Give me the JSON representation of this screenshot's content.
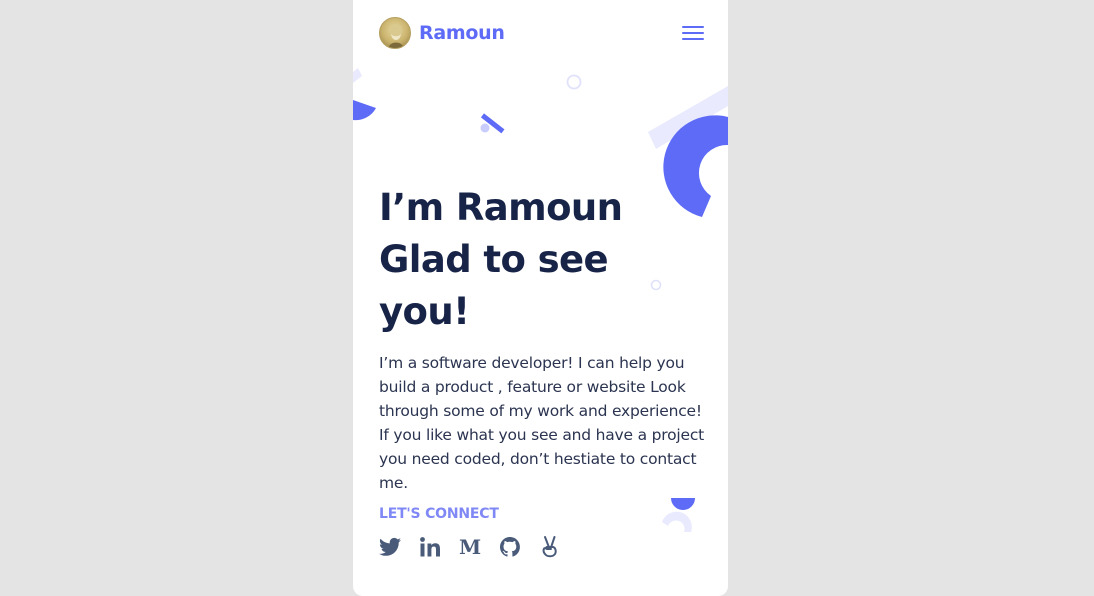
{
  "header": {
    "brand_name": "Ramoun",
    "menu_icon": "hamburger-menu-icon"
  },
  "hero": {
    "headline_line1": "I’m Ramoun",
    "headline_line2": "Glad to see",
    "headline_line3": "you!",
    "intro": "I’m a software developer! I can help you build a product , feature or website Look through some of my work and experience! If you like what you see and have a project you need coded, don’t hestiate to contact me."
  },
  "connect": {
    "label": "LET'S CONNECT",
    "links": [
      {
        "icon": "twitter-icon"
      },
      {
        "icon": "linkedin-icon"
      },
      {
        "icon": "medium-icon"
      },
      {
        "icon": "github-icon"
      },
      {
        "icon": "angellist-icon"
      }
    ]
  },
  "colors": {
    "accent": "#5d6bf6",
    "accent_light": "#e9eafd",
    "heading": "#172448",
    "body_text": "#2b3450",
    "connect_label": "#7f88f5",
    "page_background": "#e4e4e4"
  }
}
